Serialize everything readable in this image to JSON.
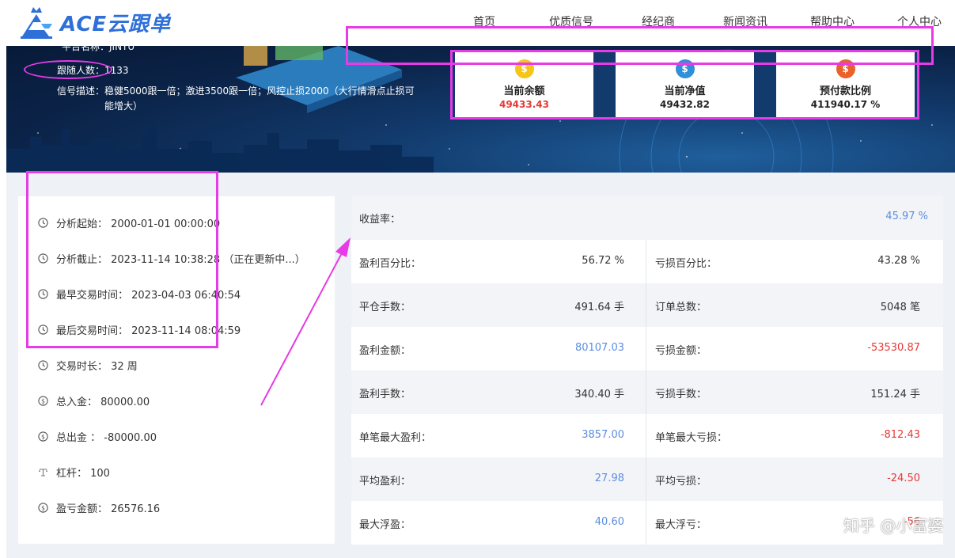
{
  "brand": {
    "logo_text": "ACE云跟单"
  },
  "nav": [
    "首页",
    "优质信号",
    "经纪商",
    "新闻资讯",
    "帮助中心",
    "个人中心"
  ],
  "signal": {
    "name_line": "平台名称：JINYU",
    "followers": "跟随人数：1133",
    "desc_label": "信号描述：",
    "desc_text": "稳健5000跟一倍；激进3500跟一倍；风控止损2000（大行情滑点止损可能增大）"
  },
  "stats": [
    {
      "label": "当前余额",
      "value": "49433.43",
      "color": "#e53935",
      "coin_color": "#f5c518",
      "icon": "money-bag-icon"
    },
    {
      "label": "当前净值",
      "value": "49432.82",
      "color": "#222222",
      "coin_color": "#2f8fd8",
      "icon": "money-bag-icon"
    },
    {
      "label": "预付款比例",
      "value": "411940.17 %",
      "color": "#222222",
      "coin_color": "#e8622a",
      "icon": "money-bag-icon"
    }
  ],
  "info": {
    "start": "分析起始： 2000-01-01 00:00:00",
    "end": "分析截止： 2023-11-14 10:38:28 （正在更新中...）",
    "first_trade": "最早交易时间： 2023-04-03 06:40:54",
    "last_trade": "最后交易时间： 2023-11-14 08:04:59",
    "duration": "交易时长： 32 周",
    "deposit": "总入金： 80000.00",
    "withdraw": "总出金 ： -80000.00",
    "leverage": "杠杆： 100",
    "pnl": "盈亏金额： 26576.16"
  },
  "yield": {
    "label": "收益率：",
    "value": "45.97 %"
  },
  "grid": [
    {
      "l1": "盈利百分比：",
      "v1": "56.72 %",
      "c1": "",
      "l2": "亏损百分比：",
      "v2": "43.28 %",
      "c2": ""
    },
    {
      "l1": "平仓手数：",
      "v1": "491.64 手",
      "c1": "",
      "l2": "订单总数：",
      "v2": "5048 笔",
      "c2": ""
    },
    {
      "l1": "盈利金额：",
      "v1": "80107.03",
      "c1": "blue",
      "l2": "亏损金额：",
      "v2": "-53530.87",
      "c2": "red"
    },
    {
      "l1": "盈利手数：",
      "v1": "340.40 手",
      "c1": "",
      "l2": "亏损手数：",
      "v2": "151.24 手",
      "c2": ""
    },
    {
      "l1": "单笔最大盈利：",
      "v1": "3857.00",
      "c1": "blue",
      "l2": "单笔最大亏损：",
      "v2": "-812.43",
      "c2": "red"
    },
    {
      "l1": "平均盈利：",
      "v1": "27.98",
      "c1": "blue",
      "l2": "平均亏损：",
      "v2": "-24.50",
      "c2": "red"
    },
    {
      "l1": "最大浮盈：",
      "v1": "40.60",
      "c1": "blue",
      "l2": "最大浮亏：",
      "v2": "-56",
      "c2": "red"
    }
  ],
  "watermark": "知乎 @小富婆",
  "colors": {
    "highlight": "#e63be6",
    "accent": "#2e6fd8"
  }
}
